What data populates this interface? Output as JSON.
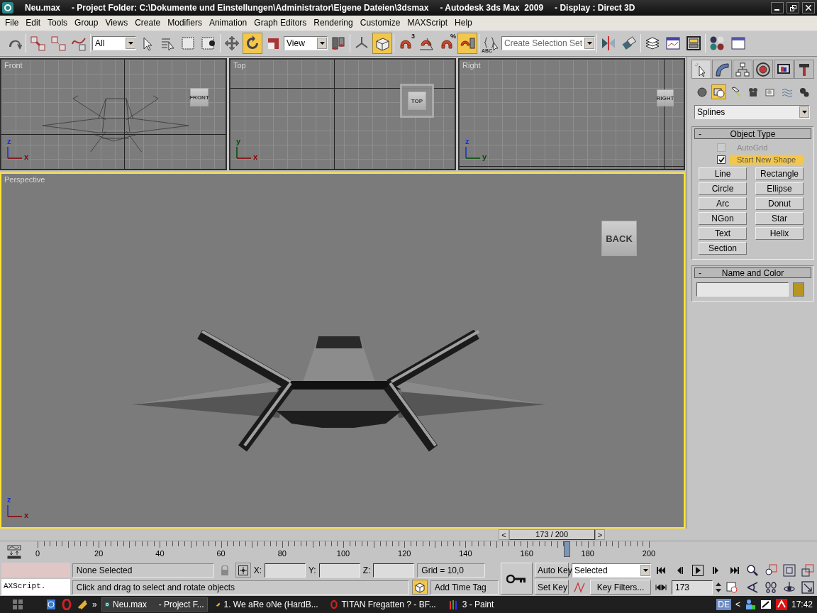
{
  "window": {
    "title_parts": [
      "Neu.max",
      "- Project Folder: C:\\Dokumente und Einstellungen\\Administrator\\Eigene Dateien\\3dsmax",
      "- Autodesk 3ds Max  2009",
      "- Display : Direct 3D"
    ]
  },
  "menu": [
    "File",
    "Edit",
    "Tools",
    "Group",
    "Views",
    "Create",
    "Modifiers",
    "Animation",
    "Graph Editors",
    "Rendering",
    "Customize",
    "MAXScript",
    "Help"
  ],
  "toolbar": [
    {
      "kind": "tool",
      "selected": false
    },
    {
      "kind": "separator"
    },
    {
      "kind": "tool",
      "selected": false
    },
    {
      "kind": "tool",
      "selected": false
    },
    {
      "kind": "tool",
      "selected": false
    },
    {
      "kind": "separator"
    },
    {
      "kind": "dropdown",
      "value": "All"
    },
    {
      "kind": "tool",
      "selected": false
    },
    {
      "kind": "tool",
      "selected": false
    },
    {
      "kind": "tool",
      "selected": false
    },
    {
      "kind": "tool",
      "selected": false
    },
    {
      "kind": "separator"
    },
    {
      "kind": "tool",
      "selected": false
    },
    {
      "kind": "tool",
      "selected": true
    },
    {
      "kind": "tool",
      "selected": false
    },
    {
      "kind": "dropdown",
      "value": "View"
    },
    {
      "kind": "tool",
      "selected": false
    },
    {
      "kind": "separator"
    },
    {
      "kind": "tool",
      "selected": false
    },
    {
      "kind": "tool",
      "selected": true
    },
    {
      "kind": "separator"
    },
    {
      "kind": "tool",
      "selected": false,
      "badge": "3"
    },
    {
      "kind": "tool",
      "selected": false
    },
    {
      "kind": "tool",
      "selected": false,
      "badge": "%"
    },
    {
      "kind": "tool",
      "selected": true
    },
    {
      "kind": "separator"
    },
    {
      "kind": "tool",
      "selected": false,
      "badge": "ABC"
    },
    {
      "kind": "dropdown",
      "placeholder": "Create Selection Set"
    },
    {
      "kind": "separator"
    },
    {
      "kind": "tool",
      "selected": false
    },
    {
      "kind": "tool",
      "selected": false
    },
    {
      "kind": "separator"
    },
    {
      "kind": "tool",
      "selected": false
    },
    {
      "kind": "tool",
      "selected": false
    },
    {
      "kind": "tool",
      "selected": false
    },
    {
      "kind": "separator"
    },
    {
      "kind": "tool",
      "selected": false
    },
    {
      "kind": "tool",
      "selected": false
    }
  ],
  "viewports": [
    {
      "label": "Front",
      "kind": "front",
      "viewcube": "FRONT",
      "axes": [
        "z",
        "x"
      ],
      "active": false
    },
    {
      "label": "Top",
      "kind": "top",
      "viewcube": "TOP",
      "axes": [
        "y",
        "x"
      ],
      "active": false
    },
    {
      "label": "Right",
      "kind": "right",
      "viewcube": "RIGHT",
      "axes": [
        "z",
        "y"
      ],
      "active": false
    },
    {
      "label": "Perspective",
      "kind": "perspective",
      "viewcube": "BACK",
      "axes": [
        "z",
        "x"
      ],
      "active": true
    }
  ],
  "command_panel": {
    "tabs": [
      {
        "selected": true
      },
      {
        "selected": false
      },
      {
        "selected": false
      },
      {
        "selected": false
      },
      {
        "selected": false
      },
      {
        "selected": false
      }
    ],
    "categories": [
      {
        "selected": false
      },
      {
        "selected": true
      },
      {
        "selected": false
      },
      {
        "selected": false
      },
      {
        "selected": false
      },
      {
        "selected": false
      },
      {
        "selected": false
      }
    ],
    "type_dropdown": "Splines",
    "object_type": {
      "collapse": "-",
      "title": "Object Type",
      "options": [
        {
          "label": "AutoGrid",
          "checked": false,
          "disabled": true
        },
        {
          "label": "Start New Shape",
          "checked": true,
          "disabled": false
        }
      ],
      "buttons": [
        "Line",
        "Rectangle",
        "Circle",
        "Ellipse",
        "Arc",
        "Donut",
        "NGon",
        "Star",
        "Text",
        "Helix",
        "Section"
      ]
    },
    "name_and_color": {
      "collapse": "-",
      "title": "Name and Color",
      "color": "#b8961e"
    }
  },
  "time_slider": {
    "prev": "<",
    "label": "173 / 200",
    "next": ">",
    "level": 0.865
  },
  "track_bar": {
    "ticks": [
      "0",
      "20",
      "40",
      "60",
      "80",
      "100",
      "120",
      "140",
      "160",
      "180",
      "200"
    ]
  },
  "status": {
    "listener": "AXScript.",
    "selection": "None Selected",
    "coords": [
      "X:",
      "Y:",
      "Z:"
    ],
    "grid": "Grid = 10,0",
    "prompt": "Click and drag to select and rotate objects",
    "time_tag": "Add Time Tag"
  },
  "animation": {
    "auto_key": {
      "label": "Auto Key",
      "on": false
    },
    "key_mode": "Selected",
    "set_key": "Set Key",
    "key_filters": "Key Filters...",
    "frame": "173"
  },
  "taskbar": {
    "more": "»",
    "tasks": [
      {
        "label": "Neu.max     - Project F...",
        "selected": true
      },
      {
        "label": "1. We aRe oNe (HardB...",
        "selected": false
      },
      {
        "label": "TITAN Fregatten ? - BF...",
        "selected": false
      },
      {
        "label": "3 - Paint",
        "selected": false
      }
    ],
    "language": "DE",
    "tray_toggle": "<",
    "clock": "17:42"
  }
}
